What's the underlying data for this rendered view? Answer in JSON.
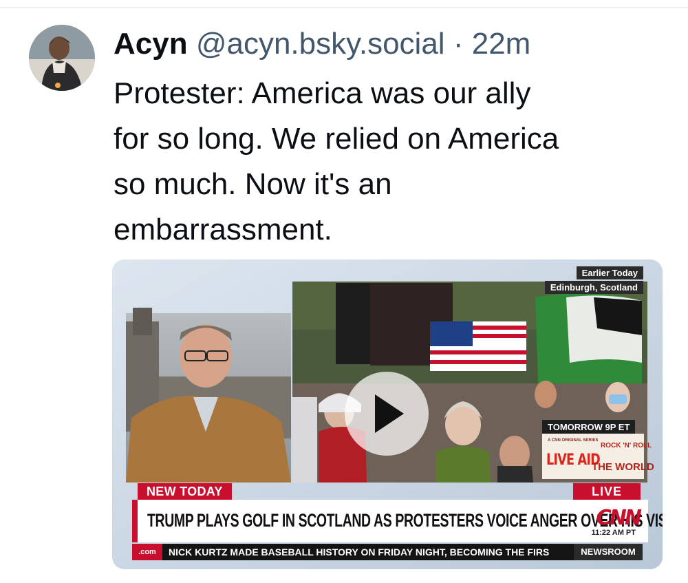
{
  "post": {
    "author_name": "Acyn",
    "handle": "@acyn.bsky.social",
    "separator": "·",
    "time": "22m",
    "text_lines": [
      "Protester: America was our ally",
      "for so long. We relied on America",
      "so much. Now it's an",
      "embarrassment."
    ]
  },
  "video": {
    "earlier_label": "Earlier Today",
    "location_label": "Edinburgh, Scotland",
    "tomorrow_label": "TOMORROW 9P ET",
    "promo": {
      "small": "A CNN ORIGINAL SERIES",
      "live_aid": "LIVE AID",
      "rock_roll": "ROCK 'N' ROLL",
      "world": "THE WORLD"
    },
    "lower_third": {
      "tag": "NEW TODAY",
      "live": "LIVE",
      "headline": "TRUMP PLAYS GOLF IN SCOTLAND AS PROTESTERS VOICE ANGER OVER HIS VISIT",
      "network_logo": "CNN",
      "clock": "11:22 AM PT"
    },
    "ticker": {
      "dotcom": ".com",
      "text": "NICK KURTZ MADE BASEBALL HISTORY ON FRIDAY NIGHT, BECOMING THE FIRS",
      "show": "NEWSROOM"
    },
    "play_icon": "play-icon"
  },
  "colors": {
    "text": "#0b0f14",
    "handle": "#42576c",
    "cnn_red": "#c8102e"
  }
}
